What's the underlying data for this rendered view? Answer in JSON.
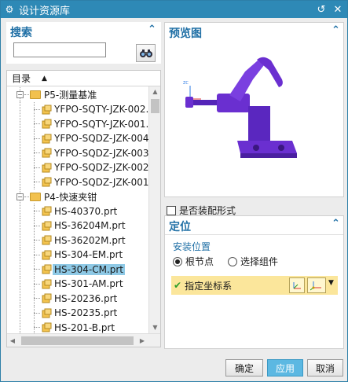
{
  "window": {
    "title": "设计资源库"
  },
  "search": {
    "title": "搜索",
    "value": "",
    "placeholder": ""
  },
  "tree": {
    "header": "目录",
    "rows": [
      {
        "label": "P5-测量基准",
        "kind": "folder",
        "level": 1,
        "expanded": true
      },
      {
        "label": "YFPO-SQTY-JZK-002.",
        "kind": "part",
        "level": 2
      },
      {
        "label": "YFPO-SQTY-JZK-001.",
        "kind": "part",
        "level": 2
      },
      {
        "label": "YFPO-SQDZ-JZK-004.",
        "kind": "part",
        "level": 2
      },
      {
        "label": "YFPO-SQDZ-JZK-003.",
        "kind": "part",
        "level": 2
      },
      {
        "label": "YFPO-SQDZ-JZK-002.",
        "kind": "part",
        "level": 2
      },
      {
        "label": "YFPO-SQDZ-JZK-001.",
        "kind": "part",
        "level": 2
      },
      {
        "label": "P4-快速夹钳",
        "kind": "folder",
        "level": 1,
        "expanded": true
      },
      {
        "label": "HS-40370.prt",
        "kind": "part",
        "level": 2
      },
      {
        "label": "HS-36204M.prt",
        "kind": "part",
        "level": 2
      },
      {
        "label": "HS-36202M.prt",
        "kind": "part",
        "level": 2
      },
      {
        "label": "HS-304-EM.prt",
        "kind": "part",
        "level": 2
      },
      {
        "label": "HS-304-CM.prt",
        "kind": "part",
        "level": 2,
        "selected": true
      },
      {
        "label": "HS-301-AM.prt",
        "kind": "part",
        "level": 2
      },
      {
        "label": "HS-20236.prt",
        "kind": "part",
        "level": 2
      },
      {
        "label": "HS-20235.prt",
        "kind": "part",
        "level": 2
      },
      {
        "label": "HS-201-B.prt",
        "kind": "part",
        "level": 2
      }
    ]
  },
  "preview": {
    "title": "预览图",
    "axis_label": "ZC"
  },
  "assembly": {
    "label": "是否装配形式",
    "checked": false
  },
  "position": {
    "title": "定位",
    "group_label": "安装位置",
    "options": [
      {
        "label": "根节点",
        "selected": true
      },
      {
        "label": "选择组件",
        "selected": false
      }
    ],
    "csys_label": "指定坐标系"
  },
  "buttons": {
    "ok": "确定",
    "apply": "应用",
    "cancel": "取消"
  },
  "colors": {
    "titlebar": "#2e89b6",
    "accent": "#1f6fa5",
    "selection": "#8ec9e6",
    "highlight_row": "#fbe69b",
    "part_color": "#6a2fd0"
  }
}
